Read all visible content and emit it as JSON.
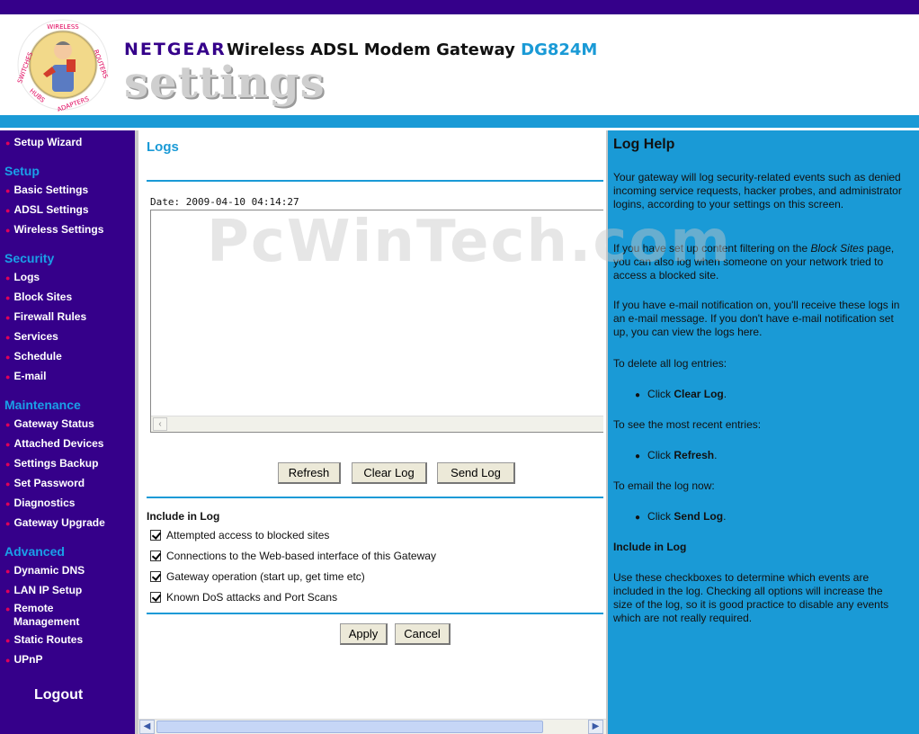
{
  "header": {
    "brand": "NETGEAR",
    "product": "Wireless ADSL Modem Gateway",
    "model": "DG824M",
    "subtitle": "settings",
    "logo_ring_text": "SWITCHES | WIRELESS | ROUTERS | ADAPTERS | HUBS"
  },
  "sidebar": {
    "setup_wizard": "Setup Wizard",
    "sections": [
      {
        "title": "Setup",
        "items": [
          "Basic Settings",
          "ADSL Settings",
          "Wireless Settings"
        ]
      },
      {
        "title": "Security",
        "items": [
          "Logs",
          "Block Sites",
          "Firewall Rules",
          "Services",
          "Schedule",
          "E-mail"
        ]
      },
      {
        "title": "Maintenance",
        "items": [
          "Gateway Status",
          "Attached Devices",
          "Settings Backup",
          "Set Password",
          "Diagnostics",
          "Gateway Upgrade"
        ]
      },
      {
        "title": "Advanced",
        "items": [
          "Dynamic DNS",
          "LAN IP Setup",
          "Remote Management",
          "Static Routes",
          "UPnP"
        ]
      }
    ],
    "remote_line1": "Remote",
    "remote_line2": "Management",
    "logout": "Logout"
  },
  "main": {
    "title": "Logs",
    "log_date": "Date: 2009-04-10 04:14:27",
    "log_content": "",
    "buttons": {
      "refresh": "Refresh",
      "clear_log": "Clear Log",
      "send_log": "Send Log",
      "apply": "Apply",
      "cancel": "Cancel"
    },
    "include_title": "Include in Log",
    "checkboxes": [
      {
        "label": "Attempted access to blocked sites",
        "checked": true
      },
      {
        "label": "Connections to the Web-based interface of this Gateway",
        "checked": true
      },
      {
        "label": "Gateway operation (start up, get time etc)",
        "checked": true
      },
      {
        "label": "Known DoS attacks and Port Scans",
        "checked": true
      }
    ]
  },
  "help": {
    "title": "Log Help",
    "p1": "Your gateway will log security-related events such as denied incoming service requests, hacker probes, and administrator logins, according to your settings on this screen.",
    "p2_before": "If you have set up content filtering on the ",
    "p2_em": "Block Sites",
    "p2_after": " page, you can also log when someone on your network tried to access a blocked site.",
    "p3": "If you have e-mail notification on, you'll receive these logs in an e-mail message. If you don't have e-mail notification set up, you can view the logs here.",
    "delete_intro": "To delete all log entries:",
    "delete_click": "Click ",
    "delete_bold": "Clear Log",
    "recent_intro": "To see the most recent entries:",
    "recent_click": "Click ",
    "recent_bold": "Refresh",
    "email_intro": "To email the log now:",
    "email_click": "Click ",
    "email_bold": "Send Log",
    "include_heading": "Include in Log",
    "include_text": "Use these checkboxes to determine which events are included in the log. Checking all options will increase the size of the log, so it is good practice to disable any events which are not really required."
  },
  "watermark": "PcWinTech.com",
  "colors": {
    "nav_bg": "#35008a",
    "accent_blue": "#1a9ad6",
    "bullet_red": "#e0005a"
  }
}
